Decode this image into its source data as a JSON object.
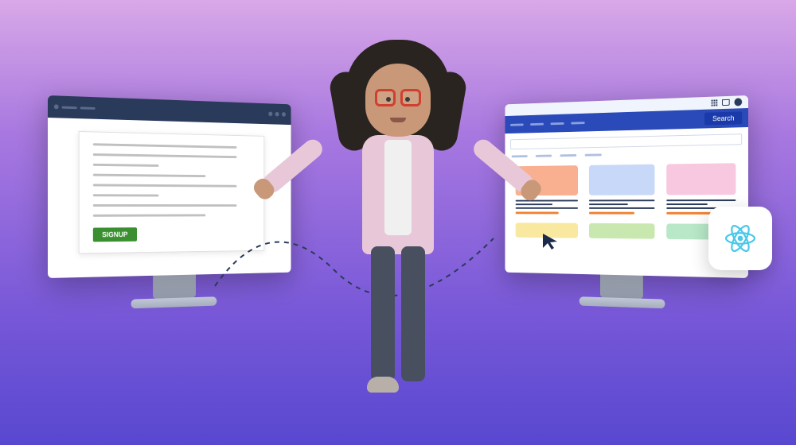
{
  "left_screen": {
    "signup_label": "SIGNUP"
  },
  "right_screen": {
    "search_label": "Search"
  },
  "icons": {
    "react": "react-icon",
    "grid": "grid-icon",
    "cart": "cart-icon",
    "user": "user-icon",
    "cursor": "cursor-icon"
  }
}
